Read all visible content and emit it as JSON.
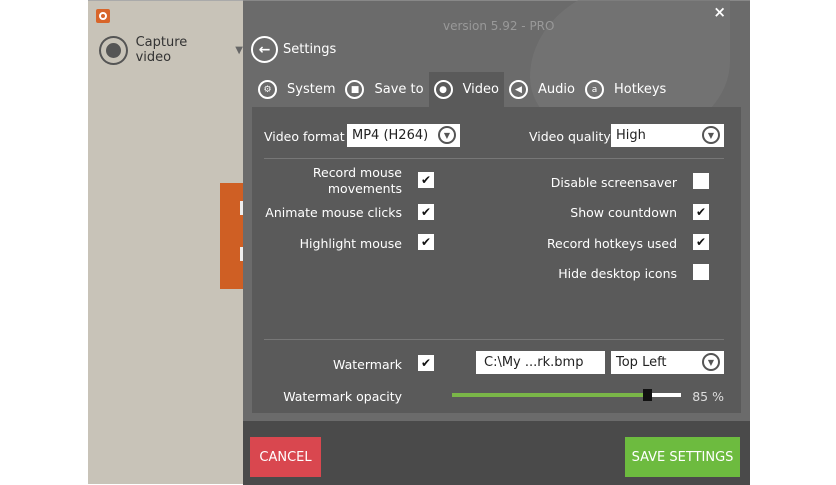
{
  "sidebar": {
    "mode_label": "Capture video"
  },
  "header": {
    "version": "version 5.92 - PRO",
    "back_label": "Settings",
    "close": "×"
  },
  "tabs": [
    {
      "label": "System",
      "icon": "gears-icon"
    },
    {
      "label": "Save to",
      "icon": "folder-icon"
    },
    {
      "label": "Video",
      "icon": "record-icon",
      "active": true
    },
    {
      "label": "Audio",
      "icon": "speaker-icon"
    },
    {
      "label": "Hotkeys",
      "icon": "key-icon"
    }
  ],
  "video": {
    "format_label": "Video format",
    "format_value": "MP4 (H264)",
    "quality_label": "Video quality",
    "quality_value": "High",
    "left_options": [
      {
        "label": "Record mouse movements",
        "checked": true
      },
      {
        "label": "Animate mouse clicks",
        "checked": true
      },
      {
        "label": "Highlight mouse",
        "checked": true
      }
    ],
    "right_options": [
      {
        "label": "Disable screensaver",
        "checked": false
      },
      {
        "label": "Show countdown",
        "checked": true
      },
      {
        "label": "Record hotkeys used",
        "checked": true
      },
      {
        "label": "Hide desktop icons",
        "checked": false
      }
    ],
    "watermark_label": "Watermark",
    "watermark_checked": true,
    "watermark_file": "C:\\My ...rk.bmp",
    "watermark_position": "Top Left",
    "opacity_label": "Watermark opacity",
    "opacity_value": 85,
    "opacity_text": "85 %"
  },
  "footer": {
    "cancel": "CANCEL",
    "save": "SAVE SETTINGS"
  },
  "colors": {
    "cancel": "#d9474f",
    "save": "#6dbb3f",
    "slider": "#7ab648"
  }
}
